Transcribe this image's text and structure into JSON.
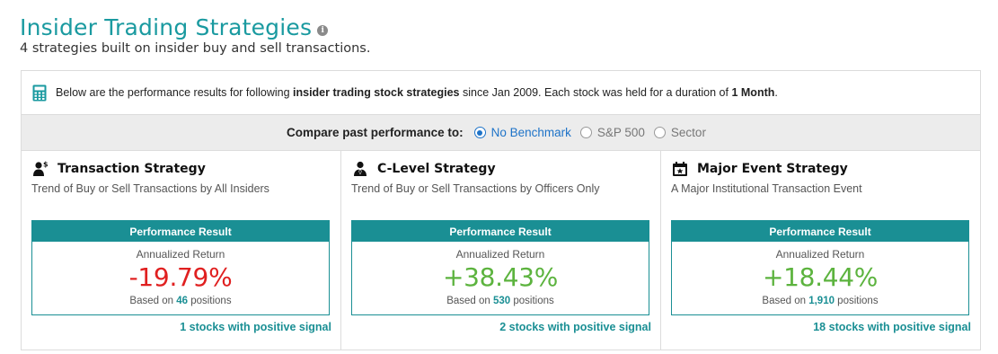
{
  "header": {
    "title": "Insider Trading Strategies",
    "info_icon": "i",
    "subtitle": "4 strategies built on insider buy and sell transactions."
  },
  "notice": {
    "icon": "calculator-icon",
    "text_before": "Below are the performance results for following ",
    "text_bold": "insider trading stock strategies",
    "text_mid": " since Jan 2009. Each stock was held for a duration of ",
    "duration": "1 Month",
    "text_end": "."
  },
  "compare": {
    "label": "Compare past performance to:",
    "options": [
      {
        "label": "No Benchmark",
        "selected": true
      },
      {
        "label": "S&P 500",
        "selected": false
      },
      {
        "label": "Sector",
        "selected": false
      }
    ]
  },
  "colors": {
    "teal": "#1a8f94",
    "negative": "#e02020",
    "positive": "#5cb33e",
    "radio_selected": "#1e73c8"
  },
  "cards": [
    {
      "icon": "insider-dollar-icon",
      "title": "Transaction Strategy",
      "description": "Trend of Buy or Sell Transactions by All Insiders",
      "perf_header": "Performance Result",
      "perf_sub": "Annualized Return",
      "value": "-19.79%",
      "value_sign": "neg",
      "based_prefix": "Based on ",
      "based_count": "46",
      "based_suffix": " positions",
      "signal": "1 stocks with positive signal"
    },
    {
      "icon": "executive-icon",
      "title": "C-Level Strategy",
      "description": "Trend of Buy or Sell Transactions by Officers Only",
      "perf_header": "Performance Result",
      "perf_sub": "Annualized Return",
      "value": "+38.43%",
      "value_sign": "pos",
      "based_prefix": "Based on ",
      "based_count": "530",
      "based_suffix": " positions",
      "signal": "2 stocks with positive signal"
    },
    {
      "icon": "calendar-star-icon",
      "title": "Major Event Strategy",
      "description": "A Major Institutional Transaction Event",
      "perf_header": "Performance Result",
      "perf_sub": "Annualized Return",
      "value": "+18.44%",
      "value_sign": "pos",
      "based_prefix": "Based on ",
      "based_count": "1,910",
      "based_suffix": " positions",
      "signal": "18 stocks with positive signal"
    }
  ]
}
